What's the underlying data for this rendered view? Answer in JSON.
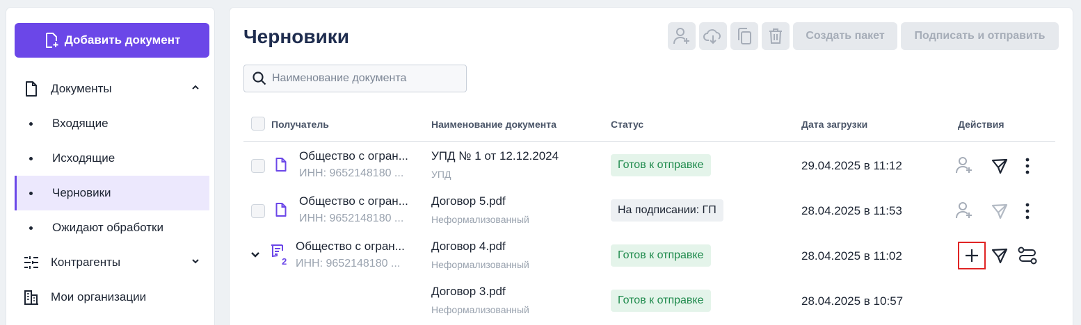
{
  "sidebar": {
    "add_button": "Добавить документ",
    "items": [
      {
        "label": "Документы",
        "icon": "document-icon"
      },
      {
        "label": "Входящие"
      },
      {
        "label": "Исходящие"
      },
      {
        "label": "Черновики"
      },
      {
        "label": "Ожидают обработки"
      },
      {
        "label": "Контрагенты",
        "icon": "contractors-icon"
      },
      {
        "label": "Мои организации",
        "icon": "building-icon"
      }
    ]
  },
  "main": {
    "title": "Черновики",
    "toolbar": {
      "create_package": "Создать пакет",
      "sign_send": "Подписать и отправить"
    },
    "search": {
      "placeholder": "Наименование документа",
      "value": ""
    },
    "columns": [
      "Получатель",
      "Наименование документа",
      "Статус",
      "Дата загрузки",
      "Действия"
    ],
    "rows": [
      {
        "recipient": "Общество с огран...",
        "inn": "ИНН: 9652148180 ...",
        "doc": "УПД № 1 от 12.12.2024",
        "doc_type": "УПД",
        "status": "Готов к отправке",
        "status_kind": "green",
        "date": "29.04.2025 в 11:12"
      },
      {
        "recipient": "Общество с огран...",
        "inn": "ИНН: 9652148180 ...",
        "doc": "Договор 5.pdf",
        "doc_type": "Неформализованный",
        "status": "На подписании: ГП",
        "status_kind": "gray",
        "date": "28.04.2025 в 11:53"
      },
      {
        "recipient": "Общество с огран...",
        "inn": "ИНН: 9652148180 ...",
        "doc": "Договор 4.pdf",
        "doc_type": "Неформализованный",
        "status": "Готов к отправке",
        "status_kind": "green",
        "date": "28.04.2025 в 11:02",
        "package_count": "2"
      },
      {
        "doc": "Договор 3.pdf",
        "doc_type": "Неформализованный",
        "status": "Готов к отправке",
        "status_kind": "green",
        "date": "28.04.2025 в 10:57"
      }
    ]
  },
  "colors": {
    "accent": "#6b47e8",
    "status_green_bg": "#e4f4ea",
    "status_green_text": "#1e8a4c",
    "highlight": "#e02424"
  }
}
